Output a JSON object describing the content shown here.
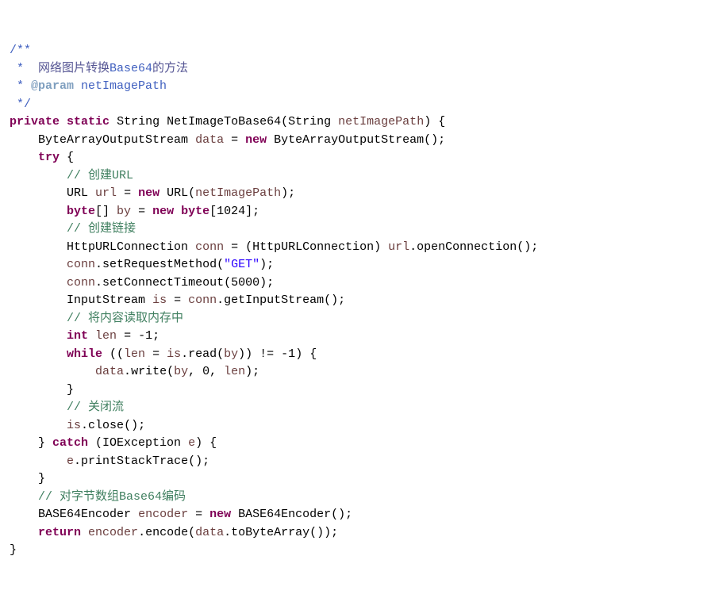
{
  "code": {
    "javadoc_open": "/**",
    "javadoc_l1_pre": " *  ",
    "javadoc_l1_cn_lead": "网络图片转换",
    "javadoc_l1_base": "Base64",
    "javadoc_l1_cn_tail": "的方法",
    "javadoc_l2_pre": " * ",
    "javadoc_l2_tag": "@param",
    "javadoc_l2_arg": " netImagePath",
    "javadoc_close": " */",
    "kw_private": "private",
    "kw_static": "static",
    "type_String": "String",
    "method_name": "NetImageToBase64",
    "param_name": "netImagePath",
    "type_BAOS": "ByteArrayOutputStream",
    "var_data": "data",
    "kw_new": "new",
    "ctor_BAOS": "ByteArrayOutputStream",
    "kw_try": "try",
    "cmt_url": "// 创建URL",
    "type_URL": "URL",
    "var_url": "url",
    "ctor_URL": "URL",
    "kw_byte": "byte",
    "var_by": "by",
    "num_1024": "1024",
    "cmt_link": "// 创建链接",
    "type_HUC": "HttpURLConnection",
    "var_conn": "conn",
    "method_open": "openConnection",
    "method_setReq": "setRequestMethod",
    "str_GET": "\"GET\"",
    "method_setTimeout": "setConnectTimeout",
    "num_5000": "5000",
    "type_IS": "InputStream",
    "var_is": "is",
    "method_getIS": "getInputStream",
    "cmt_read": "// 将内容读取内存中",
    "kw_int": "int",
    "var_len": "len",
    "num_neg1a": "-1",
    "kw_while": "while",
    "method_read": "read",
    "num_neg1b": "-1",
    "method_write": "write",
    "num_0": "0",
    "cmt_close": "// 关闭流",
    "method_close": "close",
    "kw_catch": "catch",
    "type_IOE": "IOException",
    "var_e": "e",
    "method_pst": "printStackTrace",
    "cmt_b64_lead": "// 对字节数组",
    "cmt_b64_mid": "Base64",
    "cmt_b64_tail": "编码",
    "type_B64E": "BASE64Encoder",
    "var_encoder": "encoder",
    "ctor_B64E": "BASE64Encoder",
    "kw_return": "return",
    "method_encode": "encode",
    "method_toBA": "toByteArray"
  }
}
